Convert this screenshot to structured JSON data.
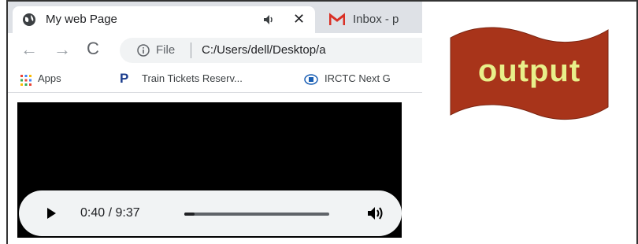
{
  "tabs": [
    {
      "title": "My web Page",
      "active": true,
      "icon": "globe-icon"
    },
    {
      "title": "Inbox - p",
      "active": false,
      "icon": "gmail-icon"
    }
  ],
  "toolbar": {
    "back_glyph": "←",
    "forward_glyph": "→",
    "reload_glyph": "C",
    "close_glyph": "✕",
    "address": {
      "scheme": "File",
      "url": "C:/Users/dell/Desktop/a"
    }
  },
  "bookmarks": [
    {
      "label": "Apps",
      "icon": "apps-grid-icon"
    },
    {
      "label": "Train Tickets Reserv...",
      "icon": "p-logo-icon"
    },
    {
      "label": "IRCTC Next G",
      "icon": "irctc-icon"
    }
  ],
  "player": {
    "time_display": "0:40 / 9:37",
    "progress": 0.07
  },
  "banner": {
    "text": "output"
  },
  "colors": {
    "banner_fill": "#a8341a",
    "banner_text": "#e8f08a",
    "gmail_red": "#d93025"
  }
}
